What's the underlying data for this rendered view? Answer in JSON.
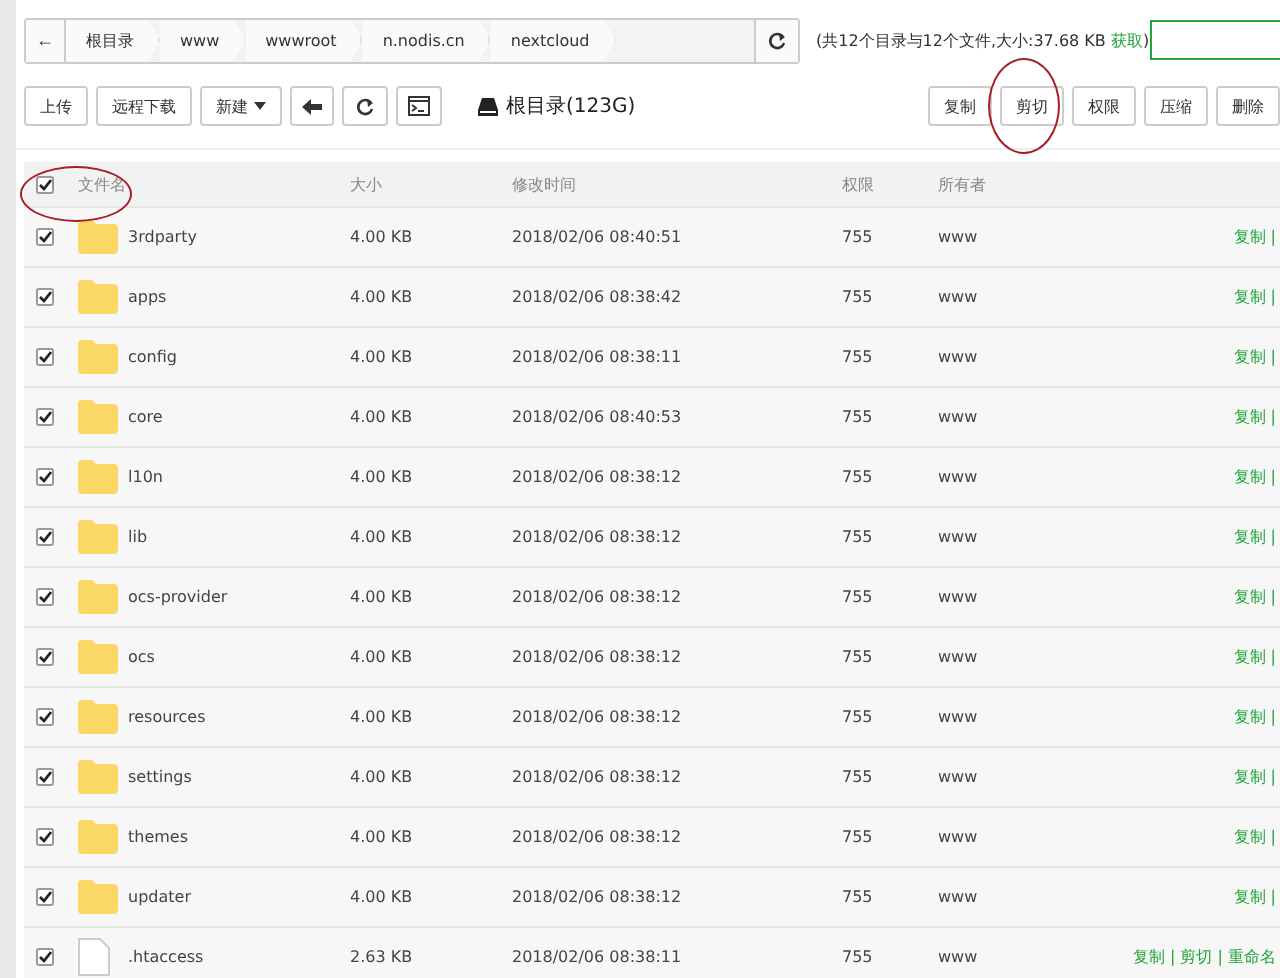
{
  "breadcrumb": {
    "back": "←",
    "crumbs": [
      "根目录",
      "www",
      "wwwroot",
      "n.nodis.cn",
      "nextcloud"
    ]
  },
  "summary": {
    "text": "(共12个目录与12个文件,大小:37.68 KB ",
    "link": "获取",
    "close": ")"
  },
  "toolbar": {
    "left_buttons": [
      {
        "label": "上传",
        "kind": "text"
      },
      {
        "label": "远程下载",
        "kind": "text"
      },
      {
        "label": "新建",
        "kind": "dropdown"
      },
      {
        "kind": "back"
      },
      {
        "kind": "refresh"
      },
      {
        "kind": "terminal"
      }
    ],
    "disk": "根目录(123G)",
    "right_buttons": [
      {
        "label": "复制",
        "highlight": false
      },
      {
        "label": "剪切",
        "highlight": true
      },
      {
        "label": "权限",
        "highlight": false
      },
      {
        "label": "压缩",
        "highlight": false
      },
      {
        "label": "删除",
        "highlight": false
      }
    ]
  },
  "table": {
    "header": {
      "checked": true,
      "highlight": true,
      "columns": [
        "文件名",
        "大小",
        "修改时间",
        "权限",
        "所有者"
      ]
    },
    "rows": [
      {
        "kind": "folder",
        "checked": true,
        "name": "3rdparty",
        "size": "4.00 KB",
        "modified": "2018/02/06 08:40:51",
        "permission": "755",
        "owner": "www",
        "actions": "复制 |"
      },
      {
        "kind": "folder",
        "checked": true,
        "name": "apps",
        "size": "4.00 KB",
        "modified": "2018/02/06 08:38:42",
        "permission": "755",
        "owner": "www",
        "actions": "复制 |"
      },
      {
        "kind": "folder",
        "checked": true,
        "name": "config",
        "size": "4.00 KB",
        "modified": "2018/02/06 08:38:11",
        "permission": "755",
        "owner": "www",
        "actions": "复制 |"
      },
      {
        "kind": "folder",
        "checked": true,
        "name": "core",
        "size": "4.00 KB",
        "modified": "2018/02/06 08:40:53",
        "permission": "755",
        "owner": "www",
        "actions": "复制 |"
      },
      {
        "kind": "folder",
        "checked": true,
        "name": "l10n",
        "size": "4.00 KB",
        "modified": "2018/02/06 08:38:12",
        "permission": "755",
        "owner": "www",
        "actions": "复制 |"
      },
      {
        "kind": "folder",
        "checked": true,
        "name": "lib",
        "size": "4.00 KB",
        "modified": "2018/02/06 08:38:12",
        "permission": "755",
        "owner": "www",
        "actions": "复制 |"
      },
      {
        "kind": "folder",
        "checked": true,
        "name": "ocs-provider",
        "size": "4.00 KB",
        "modified": "2018/02/06 08:38:12",
        "permission": "755",
        "owner": "www",
        "actions": "复制 |"
      },
      {
        "kind": "folder",
        "checked": true,
        "name": "ocs",
        "size": "4.00 KB",
        "modified": "2018/02/06 08:38:12",
        "permission": "755",
        "owner": "www",
        "actions": "复制 |"
      },
      {
        "kind": "folder",
        "checked": true,
        "name": "resources",
        "size": "4.00 KB",
        "modified": "2018/02/06 08:38:12",
        "permission": "755",
        "owner": "www",
        "actions": "复制 |"
      },
      {
        "kind": "folder",
        "checked": true,
        "name": "settings",
        "size": "4.00 KB",
        "modified": "2018/02/06 08:38:12",
        "permission": "755",
        "owner": "www",
        "actions": "复制 |"
      },
      {
        "kind": "folder",
        "checked": true,
        "name": "themes",
        "size": "4.00 KB",
        "modified": "2018/02/06 08:38:12",
        "permission": "755",
        "owner": "www",
        "actions": "复制 |"
      },
      {
        "kind": "folder",
        "checked": true,
        "name": "updater",
        "size": "4.00 KB",
        "modified": "2018/02/06 08:38:12",
        "permission": "755",
        "owner": "www",
        "actions": "复制 |"
      },
      {
        "kind": "file",
        "checked": true,
        "name": ".htaccess",
        "size": "2.63 KB",
        "modified": "2018/02/06 08:38:11",
        "permission": "755",
        "owner": "www",
        "actions": "复制 | 剪切 | 重命名"
      }
    ]
  }
}
